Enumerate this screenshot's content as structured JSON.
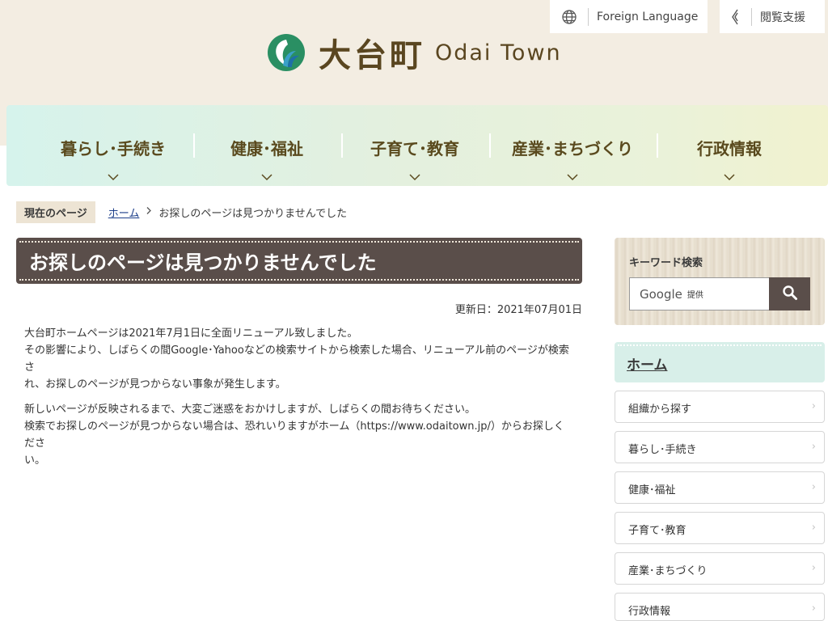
{
  "header": {
    "foreign_language": "Foreign Language",
    "accessibility": "閲覧支援",
    "logo_jp": "大台町",
    "logo_en": "Odai Town"
  },
  "global_nav": [
    {
      "label": "暮らし･手続き"
    },
    {
      "label": "健康･福祉"
    },
    {
      "label": "子育て･教育"
    },
    {
      "label": "産業･まちづくり"
    },
    {
      "label": "行政情報"
    }
  ],
  "breadcrumb": {
    "current_label": "現在のページ",
    "home": "ホーム",
    "page": "お探しのページは見つかりませんでした"
  },
  "main": {
    "title": "お探しのページは見つかりませんでした",
    "updated": "更新日：2021年07月01日",
    "para1_line1": "大台町ホームページは2021年7月1日に全面リニューアル致しました。",
    "para1_line2": "その影響により、しばらくの間Google･Yahooなどの検索サイトから検索した場合、リニューアル前のページが検索さ",
    "para1_line3": "れ、お探しのページが見つからない事象が発生します。",
    "para2_line1": "新しいページが反映されるまで、大変ご迷惑をおかけしますが、しばらくの間お待ちください。",
    "para2_line2": "検索でお探しのページが見つからない場合は、恐れいりますがホーム（https://www.odaitown.jp/）からお探しくださ",
    "para2_line3": "い。"
  },
  "sidebar": {
    "search_label": "キーワード検索",
    "search_brand": "Google",
    "search_provided": "提供",
    "home": "ホーム",
    "links": [
      {
        "label": "組織から探す"
      },
      {
        "label": "暮らし･手続き"
      },
      {
        "label": "健康･福祉"
      },
      {
        "label": "子育て･教育"
      },
      {
        "label": "産業･まちづくり"
      },
      {
        "label": "行政情報"
      }
    ]
  },
  "colors": {
    "header_bg": "#f3ede2",
    "title_bg": "#5a4e4a",
    "logo_text": "#5a4620",
    "logo_green": "#2a8f63",
    "link_blue": "#1d3f8a"
  },
  "icons": {
    "language": "globe-icon",
    "accessibility": "accessibility-icon",
    "search": "search-icon",
    "nav_toggle": "chevron-down-icon",
    "side_link": "chevron-right-icon"
  }
}
